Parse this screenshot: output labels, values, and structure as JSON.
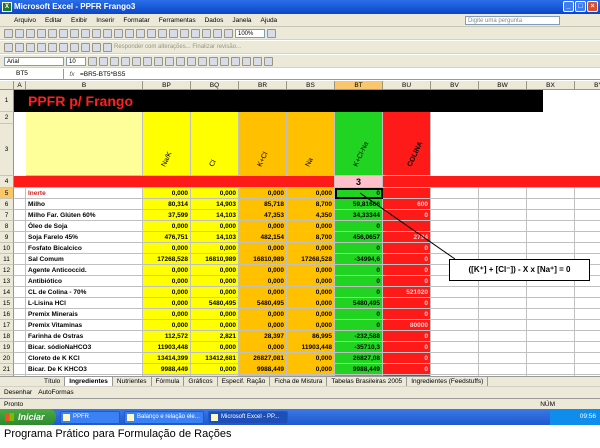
{
  "window": {
    "title": "Microsoft Excel - PPFR Frango3",
    "icon": "excel-icon"
  },
  "menu": {
    "items": [
      "Arquivo",
      "Editar",
      "Exibir",
      "Inserir",
      "Formatar",
      "Ferramentas",
      "Dados",
      "Janela",
      "Ajuda"
    ],
    "help_placeholder": "Digite uma pergunta"
  },
  "toolbar": {
    "zoom": "100%",
    "font": "Arial",
    "size": "10",
    "review_text": "Responder com alterações... Finalizar revisão..."
  },
  "formula": {
    "namebox": "BT5",
    "content": "=BR5-BT5*BS5"
  },
  "columns": [
    "A",
    "B",
    "BP",
    "BQ",
    "BR",
    "BS",
    "BT",
    "BU",
    "BV",
    "BW",
    "BX",
    "BY",
    "BZ"
  ],
  "sheet": {
    "title": "PPFR p/ Frango",
    "headers": [
      "Na/K",
      "Cl",
      "K+Cl",
      "Na",
      "K+Cl-Na",
      "COLINA"
    ],
    "row4_value": "3",
    "rows": [
      {
        "n": "5",
        "name": "Inerte",
        "v": [
          "0,000",
          "0,000",
          "0,000",
          "0,000",
          "0",
          ""
        ]
      },
      {
        "n": "6",
        "name": "Milho",
        "v": [
          "80,314",
          "14,903",
          "85,718",
          "8,700",
          "59,81666",
          "600"
        ]
      },
      {
        "n": "7",
        "name": "Milho Far. Glúten  60%",
        "v": [
          "37,599",
          "14,103",
          "47,353",
          "4,350",
          "34,33344",
          "0"
        ]
      },
      {
        "n": "8",
        "name": "Óleo de Soja",
        "v": [
          "0,000",
          "0,000",
          "0,000",
          "0,000",
          "0",
          ""
        ]
      },
      {
        "n": "9",
        "name": "Soja Farelo  45%",
        "v": [
          "476,751",
          "14,103",
          "482,154",
          "8,700",
          "456,0657",
          "2794"
        ]
      },
      {
        "n": "10",
        "name": "Fosfato Bicalcico",
        "v": [
          "0,000",
          "0,000",
          "0,000",
          "0,000",
          "0",
          "0"
        ]
      },
      {
        "n": "11",
        "name": "Sal Comum",
        "v": [
          "17268,528",
          "16810,989",
          "16810,989",
          "17268,528",
          "-34994,6",
          "0"
        ]
      },
      {
        "n": "12",
        "name": "Agente Anticoccid.",
        "v": [
          "0,000",
          "0,000",
          "0,000",
          "0,000",
          "0",
          "0"
        ]
      },
      {
        "n": "13",
        "name": "Antibiótico",
        "v": [
          "0,000",
          "0,000",
          "0,000",
          "0,000",
          "0",
          "0"
        ]
      },
      {
        "n": "14",
        "name": "CL de Colina - 70%",
        "v": [
          "0,000",
          "0,000",
          "0,000",
          "0,000",
          "0",
          "521020"
        ]
      },
      {
        "n": "15",
        "name": "L-Lisina HCl",
        "v": [
          "0,000",
          "5480,495",
          "5480,495",
          "0,000",
          "5480,495",
          "0"
        ]
      },
      {
        "n": "16",
        "name": "Premix Minerais",
        "v": [
          "0,000",
          "0,000",
          "0,000",
          "0,000",
          "0",
          "0"
        ]
      },
      {
        "n": "17",
        "name": "Premix Vitaminas",
        "v": [
          "0,000",
          "0,000",
          "0,000",
          "0,000",
          "0",
          "80000"
        ]
      },
      {
        "n": "18",
        "name": "Farinha de Ostras",
        "v": [
          "112,572",
          "2,821",
          "28,397",
          "86,995",
          "-232,588",
          "0"
        ]
      },
      {
        "n": "19",
        "name": "Bicar. sódioNaHCO3",
        "v": [
          "11903,448",
          "0,000",
          "0,000",
          "11903,448",
          "-35710,3",
          "0"
        ]
      },
      {
        "n": "20",
        "name": "Cloreto de K KCl",
        "v": [
          "13414,399",
          "13412,681",
          "26827,081",
          "0,000",
          "26827,08",
          "0"
        ]
      },
      {
        "n": "21",
        "name": "Bicar. De K KHCO3",
        "v": [
          "9988,449",
          "0,000",
          "9988,449",
          "0,000",
          "9988,449",
          "0"
        ]
      },
      {
        "n": "22",
        "name": "Cloreto de Ca CaCl2",
        "v": [
          "0,000",
          "18019,740",
          "18019,740",
          "0,000",
          "18019,74",
          "0"
        ]
      },
      {
        "n": "23",
        "name": "Cloreto de Na NaCl",
        "v": [
          "17111,716",
          "17111,716",
          "17111,716",
          "17111,716",
          "-34226",
          "0"
        ]
      }
    ]
  },
  "callout": "([K⁺] + [Cl⁻]) - X x [Na⁺] = 0",
  "tabs": [
    "Título",
    "Ingredientes",
    "Nutrientes",
    "Fórmula",
    "Gráficos",
    "Especif. Ração",
    "Ficha de Mistura",
    "Tabelas Brasileiras 2005",
    "Ingredientes (Feedstuffs)"
  ],
  "drawbar": {
    "desenhar": "Desenhar",
    "autoformas": "AutoFormas"
  },
  "status": {
    "left": "Pronto",
    "right": "NÚM"
  },
  "taskbar": {
    "start": "Iniciar",
    "tasks": [
      "PPFR",
      "Balanço e relação ele...",
      "Microsoft Excel - PP..."
    ],
    "clock": "09:56"
  },
  "caption": "Programa Prático para Formulação de Rações"
}
